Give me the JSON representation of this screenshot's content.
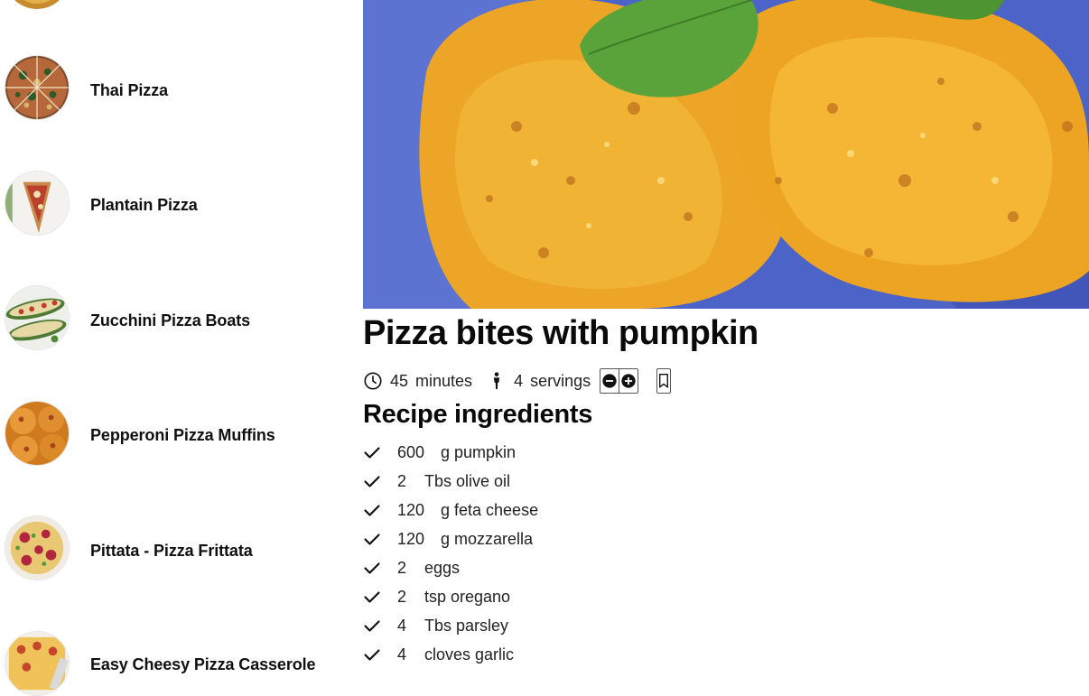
{
  "sidebar": {
    "items": [
      {
        "title": "Thai Pizza",
        "thumb_icon": "thai-pizza-thumbnail"
      },
      {
        "title": "Plantain Pizza",
        "thumb_icon": "plantain-pizza-thumbnail"
      },
      {
        "title": "Zucchini Pizza Boats",
        "thumb_icon": "zucchini-pizza-thumbnail"
      },
      {
        "title": "Pepperoni Pizza Muffins",
        "thumb_icon": "muffins-thumbnail"
      },
      {
        "title": "Pittata - Pizza Frittata",
        "thumb_icon": "frittata-thumbnail"
      },
      {
        "title": "Easy Cheesy Pizza Casserole",
        "thumb_icon": "casserole-thumbnail"
      }
    ]
  },
  "recipe": {
    "title": "Pizza bites with pumpkin",
    "time_value": "45",
    "time_unit": "minutes",
    "servings_value": "4",
    "servings_unit": "servings",
    "section_title": "Recipe ingredients",
    "ingredients": [
      {
        "qty": "600",
        "text": "g pumpkin"
      },
      {
        "qty": "2",
        "text": "Tbs olive oil"
      },
      {
        "qty": "120",
        "text": "g feta cheese"
      },
      {
        "qty": "120",
        "text": "g mozzarella"
      },
      {
        "qty": "2",
        "text": "eggs"
      },
      {
        "qty": "2",
        "text": "tsp oregano"
      },
      {
        "qty": "4",
        "text": "Tbs parsley"
      },
      {
        "qty": "4",
        "text": "cloves garlic"
      }
    ]
  },
  "colors": {
    "text": "#111111",
    "plate_blue": "#4c63c7",
    "bite_orange": "#f0a826",
    "basil_green": "#5aa33a"
  },
  "icons": {
    "time": "clock-icon",
    "servings": "person-icon",
    "decrease": "minus-circle-icon",
    "increase": "plus-circle-icon",
    "bookmark": "bookmark-icon",
    "check": "check-icon"
  }
}
